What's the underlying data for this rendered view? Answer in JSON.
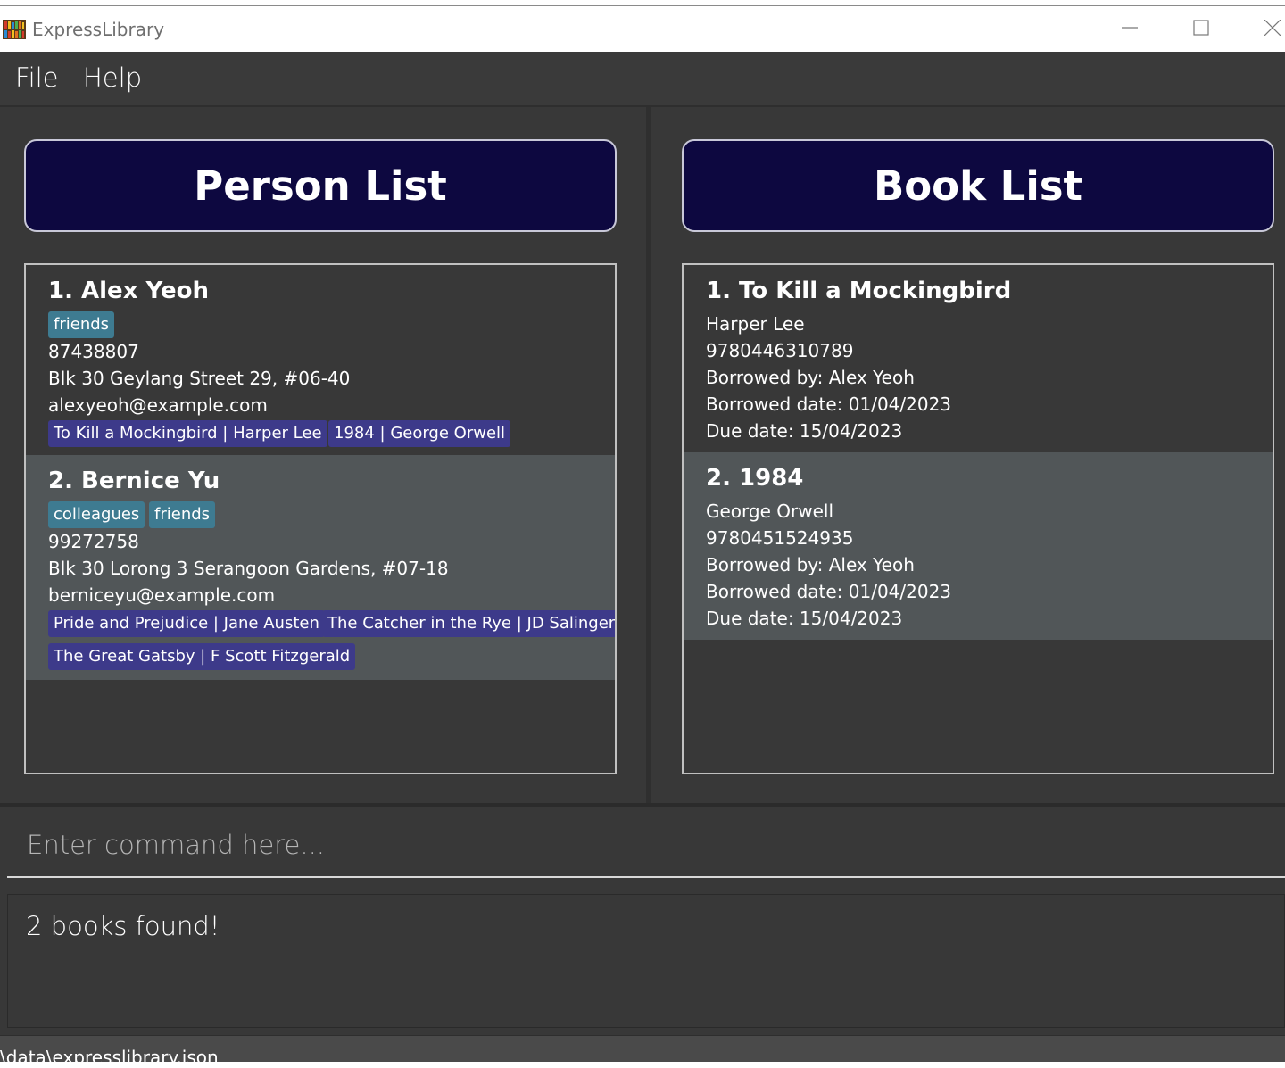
{
  "window": {
    "title": "ExpressLibrary"
  },
  "menu": {
    "file": "File",
    "help": "Help"
  },
  "person_list": {
    "header": "Person List",
    "persons": [
      {
        "index_name": "1.  Alex Yeoh",
        "tags": [
          "friends"
        ],
        "phone": "87438807",
        "address": "Blk 30 Geylang Street 29, #06-40",
        "email": "alexyeoh@example.com",
        "books": [
          "To Kill a Mockingbird | Harper Lee",
          "1984 | George Orwell"
        ]
      },
      {
        "index_name": "2.  Bernice Yu",
        "tags": [
          "colleagues",
          "friends"
        ],
        "phone": "99272758",
        "address": "Blk 30 Lorong 3 Serangoon Gardens, #07-18",
        "email": "berniceyu@example.com",
        "books": [
          "Pride and Prejudice | Jane Austen",
          "The Catcher in the Rye | JD Salinger",
          "The Great Gatsby | F Scott Fitzgerald"
        ]
      }
    ]
  },
  "book_list": {
    "header": "Book List",
    "books": [
      {
        "index_title": "1.  To Kill a Mockingbird",
        "author": "Harper Lee",
        "isbn": "9780446310789",
        "borrowed_by": "Borrowed by: Alex Yeoh",
        "borrowed_date": "Borrowed date: 01/04/2023",
        "due_date": "Due date: 15/04/2023"
      },
      {
        "index_title": "2.  1984",
        "author": "George Orwell",
        "isbn": "9780451524935",
        "borrowed_by": "Borrowed by: Alex Yeoh",
        "borrowed_date": "Borrowed date: 01/04/2023",
        "due_date": "Due date: 15/04/2023"
      }
    ]
  },
  "command": {
    "placeholder": "Enter command here..."
  },
  "result": {
    "text": "2 books found!"
  },
  "status": {
    "path": "\\data\\expresslibrary.json"
  },
  "colors": {
    "header_bg": "#0d0840",
    "tag_label": "#3e7b91",
    "tag_book": "#3d3a8a",
    "app_bg": "#383838",
    "odd_row": "#515658"
  },
  "icons": {
    "app": "bookshelf-icon",
    "minimize": "minimize-icon",
    "maximize": "maximize-icon",
    "close": "close-icon"
  }
}
